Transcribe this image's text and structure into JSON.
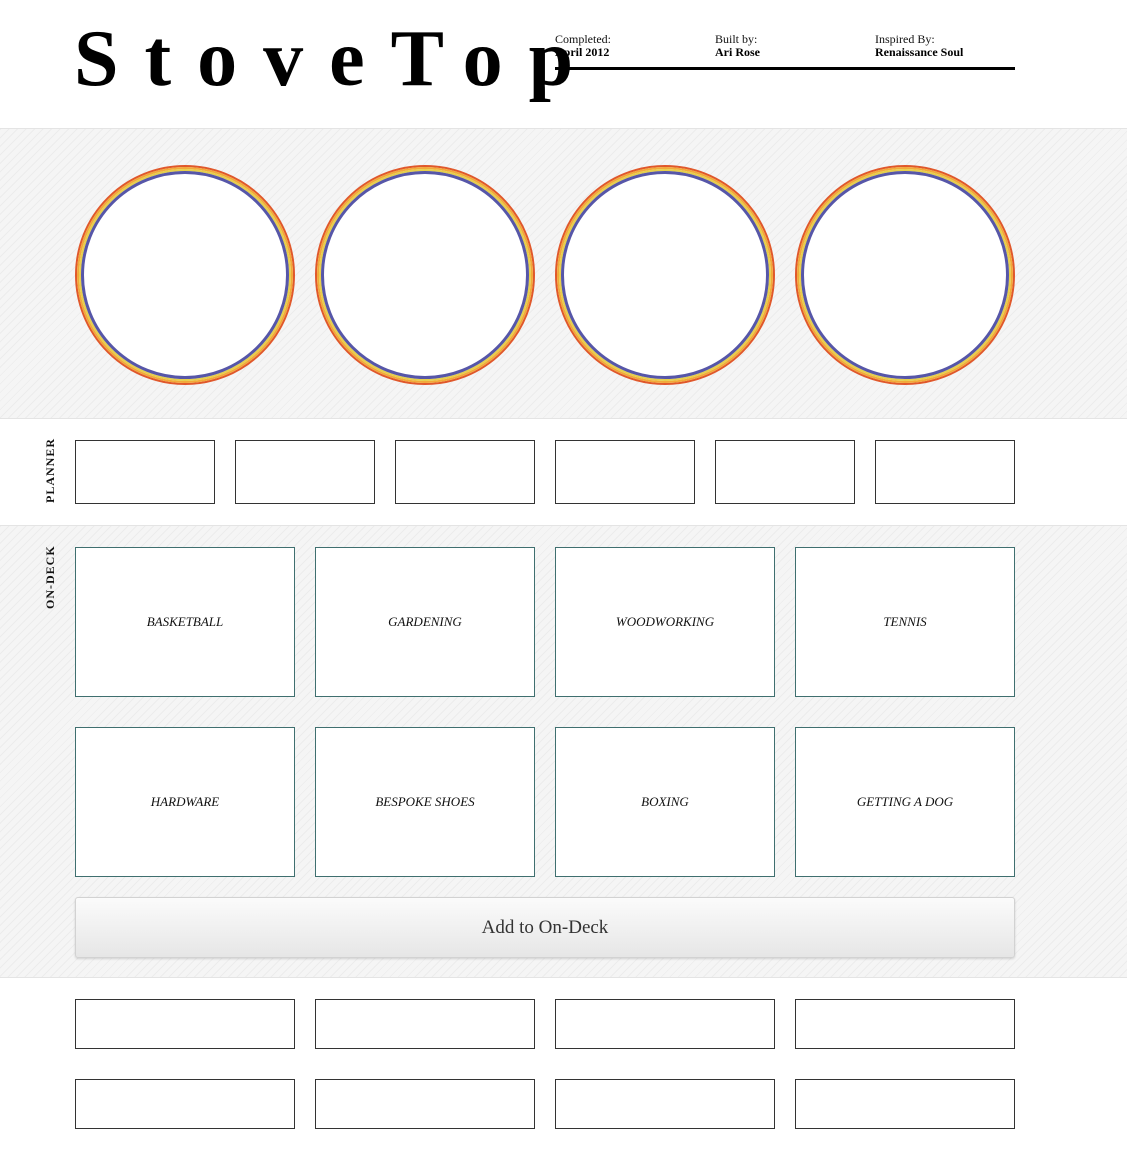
{
  "header": {
    "logo": "StoveTop",
    "completed_label": "Completed:",
    "completed_value": "April 2012",
    "built_label": "Built by:",
    "built_value": "Ari Rose",
    "inspired_label": "Inspired By:",
    "inspired_value": "Renaissance Soul"
  },
  "burners": {
    "count": 4,
    "colors": [
      "#e0582b",
      "#f2a83a",
      "#e6cf4a",
      "#5656a8"
    ]
  },
  "planner": {
    "label": "PLANNER",
    "slot_count": 6
  },
  "ondeck": {
    "label": "ON-DECK",
    "items": [
      "BASKETBALL",
      "GARDENING",
      "WOODWORKING",
      "TENNIS",
      "HARDWARE",
      "BESPOKE SHOES",
      "BOXING",
      "GETTING A DOG"
    ],
    "add_button": "Add to On-Deck"
  },
  "bottom": {
    "slot_count": 8
  }
}
